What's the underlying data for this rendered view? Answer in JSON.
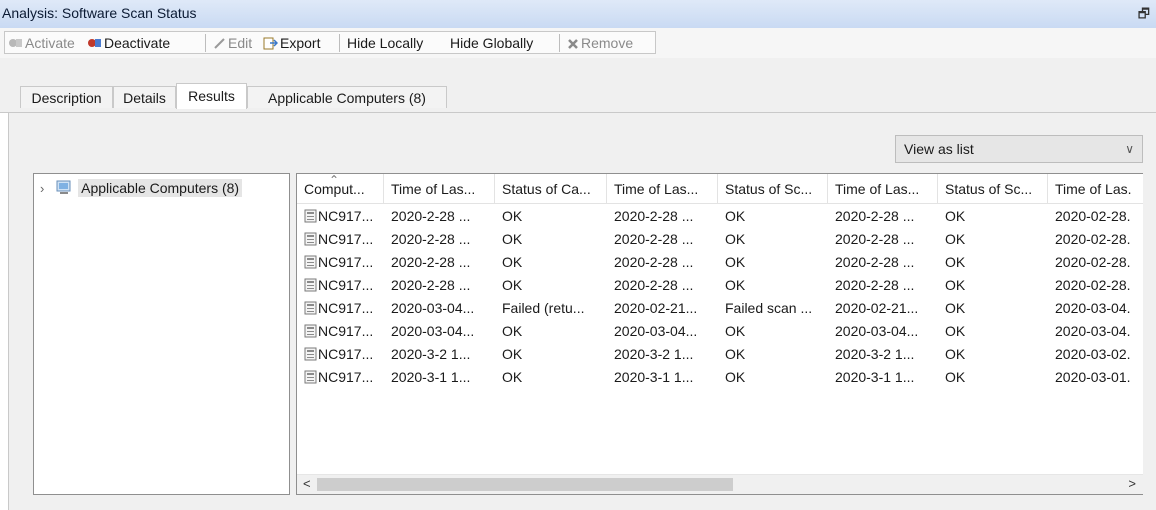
{
  "window": {
    "title": "Analysis: Software Scan Status"
  },
  "toolbar": {
    "activate": "Activate",
    "deactivate": "Deactivate",
    "edit": "Edit",
    "export": "Export",
    "hide_locally": "Hide Locally",
    "hide_globally": "Hide Globally",
    "remove": "Remove"
  },
  "tabs": [
    "Description",
    "Details",
    "Results",
    "Applicable Computers (8)"
  ],
  "view_select": {
    "value": "View as list"
  },
  "tree": {
    "node": "Applicable Computers (8)"
  },
  "grid": {
    "columns": [
      "Comput...",
      "Time of Las...",
      "Status of Ca...",
      "Time of Las...",
      "Status of Sc...",
      "Time of Las...",
      "Status of Sc...",
      "Time of Las."
    ],
    "rows": [
      [
        "NC917...",
        "2020-2-28 ...",
        "OK",
        "2020-2-28 ...",
        "OK",
        "2020-2-28 ...",
        "OK",
        "2020-02-28."
      ],
      [
        "NC917...",
        "2020-2-28 ...",
        "OK",
        "2020-2-28 ...",
        "OK",
        "2020-2-28 ...",
        "OK",
        "2020-02-28."
      ],
      [
        "NC917...",
        "2020-2-28 ...",
        "OK",
        "2020-2-28 ...",
        "OK",
        "2020-2-28 ...",
        "OK",
        "2020-02-28."
      ],
      [
        "NC917...",
        "2020-2-28 ...",
        "OK",
        "2020-2-28 ...",
        "OK",
        "2020-2-28 ...",
        "OK",
        "2020-02-28."
      ],
      [
        "NC917...",
        "2020-03-04...",
        "Failed (retu...",
        "2020-02-21...",
        "Failed scan ...",
        "2020-02-21...",
        "OK",
        "2020-03-04."
      ],
      [
        "NC917...",
        "2020-03-04...",
        "OK",
        "2020-03-04...",
        "OK",
        "2020-03-04...",
        "OK",
        "2020-03-04."
      ],
      [
        "NC917...",
        "2020-3-2 1...",
        "OK",
        "2020-3-2 1...",
        "OK",
        "2020-3-2 1...",
        "OK",
        "2020-03-02."
      ],
      [
        "NC917...",
        "2020-3-1 1...",
        "OK",
        "2020-3-1 1...",
        "OK",
        "2020-3-1 1...",
        "OK",
        "2020-03-01."
      ]
    ]
  },
  "scrollbar": {
    "left_arrow": "<",
    "right_arrow": ">"
  }
}
